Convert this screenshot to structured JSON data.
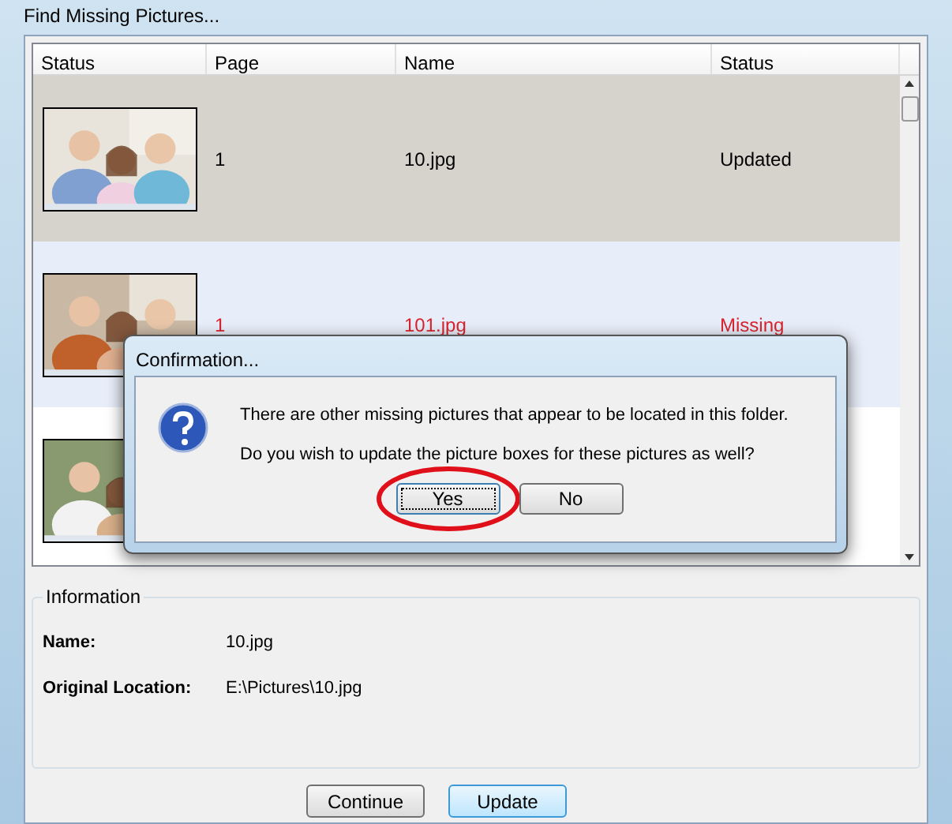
{
  "window": {
    "title": "Find Missing Pictures..."
  },
  "table": {
    "columns": [
      "Status",
      "Page",
      "Name",
      "Status"
    ],
    "rows": [
      {
        "kind": "updated",
        "selected": true,
        "page": "1",
        "name": "10.jpg",
        "status": "Updated"
      },
      {
        "kind": "missing",
        "selected": false,
        "page": "1",
        "name": "101.jpg",
        "status": "Missing"
      },
      {
        "kind": "covered",
        "selected": false
      }
    ]
  },
  "dialog": {
    "title": "Confirmation...",
    "messages": [
      "There are other missing pictures that appear to be located in this folder.",
      "Do you wish to update the picture boxes for these pictures as well?"
    ],
    "buttons": [
      {
        "label": "Yes",
        "focused": true,
        "circled": true
      },
      {
        "label": "No",
        "focused": false,
        "circled": false
      }
    ]
  },
  "information": {
    "title": "Information",
    "fields": [
      {
        "label": "Name:",
        "value": "10.jpg"
      },
      {
        "label": "Original Location:",
        "value": "E:\\Pictures\\10.jpg"
      }
    ]
  },
  "buttons": [
    {
      "label": "Continue",
      "focused": false
    },
    {
      "label": "Update",
      "focused": true
    }
  ]
}
